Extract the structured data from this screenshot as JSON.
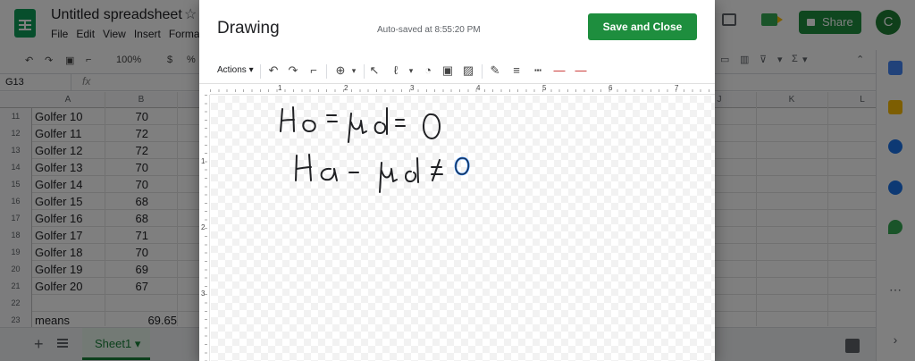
{
  "spreadsheet": {
    "title": "Untitled spreadsheet",
    "menu": [
      "File",
      "Edit",
      "View",
      "Insert",
      "Forma"
    ],
    "zoom": "100%",
    "currency": "$",
    "percent": "%",
    "name_box": "G13",
    "fx": "fx",
    "share_label": "Share",
    "avatar_initial": "C",
    "columns": [
      "A",
      "B",
      "J",
      "K",
      "L"
    ],
    "rows": [
      {
        "num": "11",
        "a": "Golfer 10",
        "b": "70"
      },
      {
        "num": "12",
        "a": "Golfer 11",
        "b": "72"
      },
      {
        "num": "13",
        "a": "Golfer 12",
        "b": "72"
      },
      {
        "num": "14",
        "a": "Golfer 13",
        "b": "70"
      },
      {
        "num": "15",
        "a": "Golfer 14",
        "b": "70"
      },
      {
        "num": "16",
        "a": "Golfer 15",
        "b": "68"
      },
      {
        "num": "17",
        "a": "Golfer 16",
        "b": "68"
      },
      {
        "num": "18",
        "a": "Golfer 17",
        "b": "71"
      },
      {
        "num": "19",
        "a": "Golfer 18",
        "b": "70"
      },
      {
        "num": "20",
        "a": "Golfer 19",
        "b": "69"
      },
      {
        "num": "21",
        "a": "Golfer 20",
        "b": "67"
      },
      {
        "num": "22",
        "a": "",
        "b": ""
      },
      {
        "num": "23",
        "a": "means",
        "b": "69.65"
      }
    ],
    "sheet_tab": "Sheet1"
  },
  "drawing": {
    "title": "Drawing",
    "autosave": "Auto-saved at 8:55:20 PM",
    "save_close_label": "Save and Close",
    "actions_label": "Actions",
    "ruler_h": [
      "1",
      "2",
      "3",
      "4",
      "5",
      "6",
      "7"
    ],
    "ruler_v": [
      "1",
      "2",
      "3"
    ],
    "ink_color": "#202124",
    "ink_highlight": "#1a73e8"
  },
  "colors": {
    "brand_green": "#1e8e3e",
    "overlay": "rgba(0,0,0,0.5)"
  }
}
